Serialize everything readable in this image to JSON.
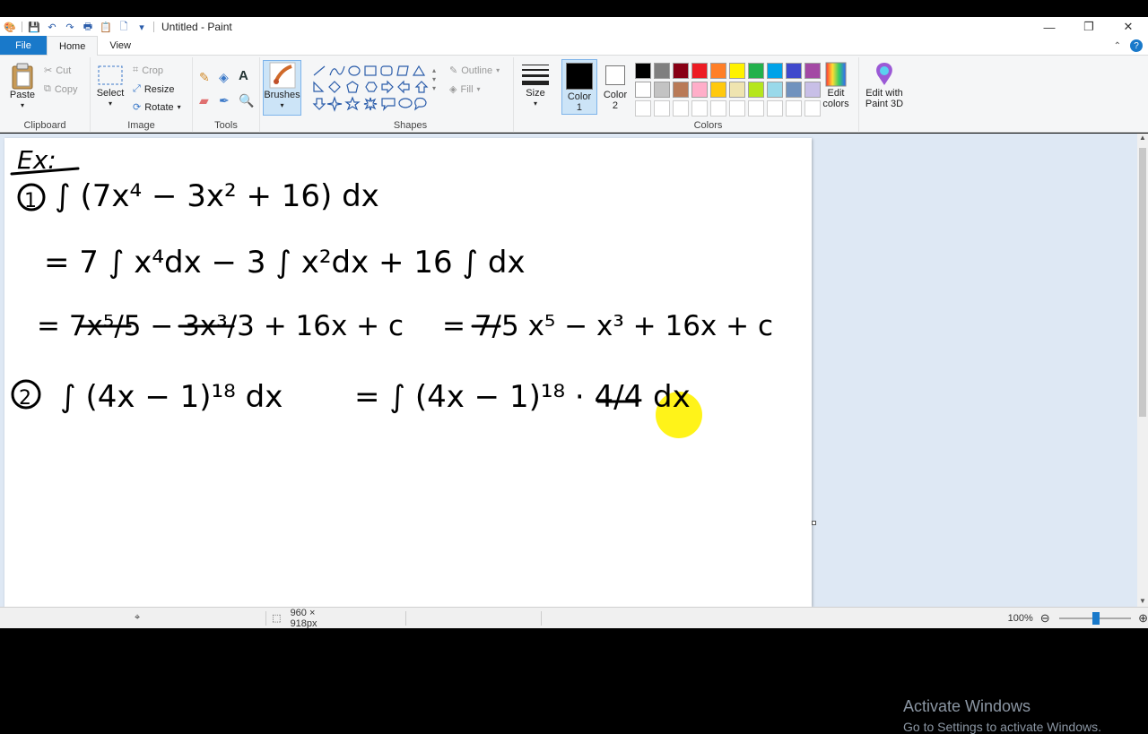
{
  "window": {
    "title": "Untitled - Paint"
  },
  "tabs": {
    "file": "File",
    "home": "Home",
    "view": "View"
  },
  "ribbon": {
    "clipboard": {
      "paste": "Paste",
      "cut": "Cut",
      "copy": "Copy",
      "label": "Clipboard"
    },
    "image": {
      "select": "Select",
      "crop": "Crop",
      "resize": "Resize",
      "rotate": "Rotate",
      "label": "Image"
    },
    "tools": {
      "label": "Tools",
      "text_tool": "A"
    },
    "brushes": {
      "label": "Brushes"
    },
    "shapes": {
      "outline": "Outline",
      "fill": "Fill",
      "label": "Shapes"
    },
    "size": {
      "label": "Size"
    },
    "colors": {
      "color1": "Color\n1",
      "color2": "Color\n2",
      "label": "Colors",
      "edit_colors": "Edit\ncolors",
      "paint3d": "Edit with\nPaint 3D",
      "color1_value": "#000000",
      "color2_value": "#ffffff",
      "palette_row1": [
        "#000000",
        "#7f7f7f",
        "#880015",
        "#ed1c24",
        "#ff7f27",
        "#fff200",
        "#22b14c",
        "#00a2e8",
        "#3f48cc",
        "#a349a4"
      ],
      "palette_row2": [
        "#ffffff",
        "#c3c3c3",
        "#b97a57",
        "#ffaec9",
        "#ffc90e",
        "#efe4b0",
        "#b5e61d",
        "#99d9ea",
        "#7092be",
        "#c8bfe7"
      ],
      "palette_row3": [
        "#ffffff",
        "#ffffff",
        "#ffffff",
        "#ffffff",
        "#ffffff",
        "#ffffff",
        "#ffffff",
        "#ffffff",
        "#ffffff",
        "#ffffff"
      ]
    }
  },
  "canvas_text": {
    "ex": "Ex:",
    "line1_num": "1",
    "line1": "∫ (7x⁴ − 3x² + 16) dx",
    "line2": "= 7 ∫ x⁴dx − 3 ∫ x²dx + 16 ∫ dx",
    "line3_a": "= 7x⁵/5 − 3x³/3 + 16x + c",
    "line3_b": "= 7/5 x⁵ − x³ + 16x + c",
    "line4_num": "2",
    "line4_a": "∫ (4x − 1)¹⁸ dx",
    "line4_b": "= ∫ (4x − 1)¹⁸ · 4/4 dx"
  },
  "status": {
    "dimensions": "960 × 918px",
    "zoom": "100%"
  },
  "watermark": {
    "title": "Activate Windows",
    "subtitle": "Go to Settings to activate Windows."
  }
}
